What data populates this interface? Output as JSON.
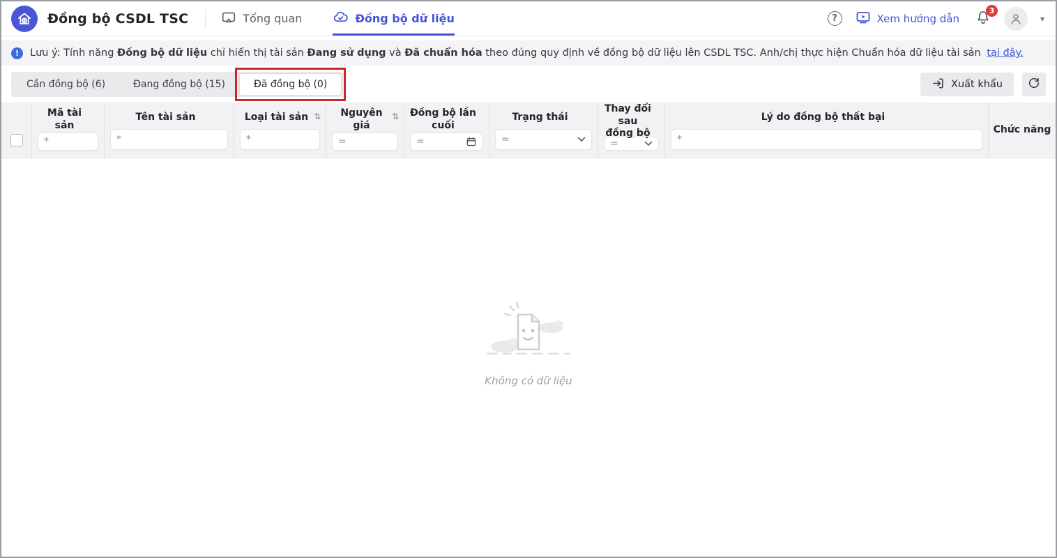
{
  "colors": {
    "accent": "#4254d5",
    "annotation_red": "#cf2428",
    "badge_red": "#e53935",
    "notice_bg": "#f4f4f6",
    "table_header_bg": "#f2f2f4"
  },
  "header": {
    "title": "Đồng bộ CSDL TSC",
    "tabs": [
      {
        "label": "Tổng quan",
        "active": false
      },
      {
        "label": "Đồng bộ dữ liệu",
        "active": true
      }
    ],
    "help_link": "Xem hướng dẫn",
    "notification_count": "3"
  },
  "icons": {
    "help_glyph": "?",
    "info_glyph": "!",
    "caret_glyph": "▾",
    "sort_glyph": "⇅"
  },
  "notice": {
    "prefix": "Lưu ý: Tính năng ",
    "bold1": "Đồng bộ dữ liệu",
    "mid1": " chỉ hiển thị tài sản ",
    "bold2": "Đang sử dụng",
    "mid2": " và ",
    "bold3": "Đã chuẩn hóa",
    "suffix": " theo đúng quy định về đồng bộ dữ liệu lên CSDL TSC. Anh/chị thực hiện Chuẩn hóa dữ liệu tài sản ",
    "link": "tại đây."
  },
  "toolbar": {
    "segments": [
      {
        "label": "Cần đồng bộ (6)",
        "selected": false
      },
      {
        "label": "Đang đồng bộ (15)",
        "selected": false
      },
      {
        "label": "Đã đồng bộ (0)",
        "selected": true,
        "annotated": true
      }
    ],
    "export_label": "Xuất khẩu"
  },
  "table": {
    "columns": [
      {
        "label": "",
        "type": "checkbox"
      },
      {
        "label": "Mã tài sản",
        "operator": "*"
      },
      {
        "label": "Tên tài sản",
        "operator": "*"
      },
      {
        "label": "Loại tài sản",
        "operator": "*",
        "sortable": true
      },
      {
        "label": "Nguyên giá",
        "operator": "=",
        "sortable": true
      },
      {
        "label": "Đồng bộ lần cuối",
        "operator": "=",
        "right_icon": "calendar"
      },
      {
        "label": "Trạng thái",
        "operator": "=",
        "right_icon": "chevron-down"
      },
      {
        "label": "Thay đổi sau đồng bộ",
        "operator": "=",
        "right_icon": "chevron-down"
      },
      {
        "label": "Lý do đồng bộ thất bại",
        "operator": "*"
      },
      {
        "label": "Chức năng"
      }
    ],
    "rows": []
  },
  "empty_state": {
    "message": "Không có dữ liệu"
  }
}
